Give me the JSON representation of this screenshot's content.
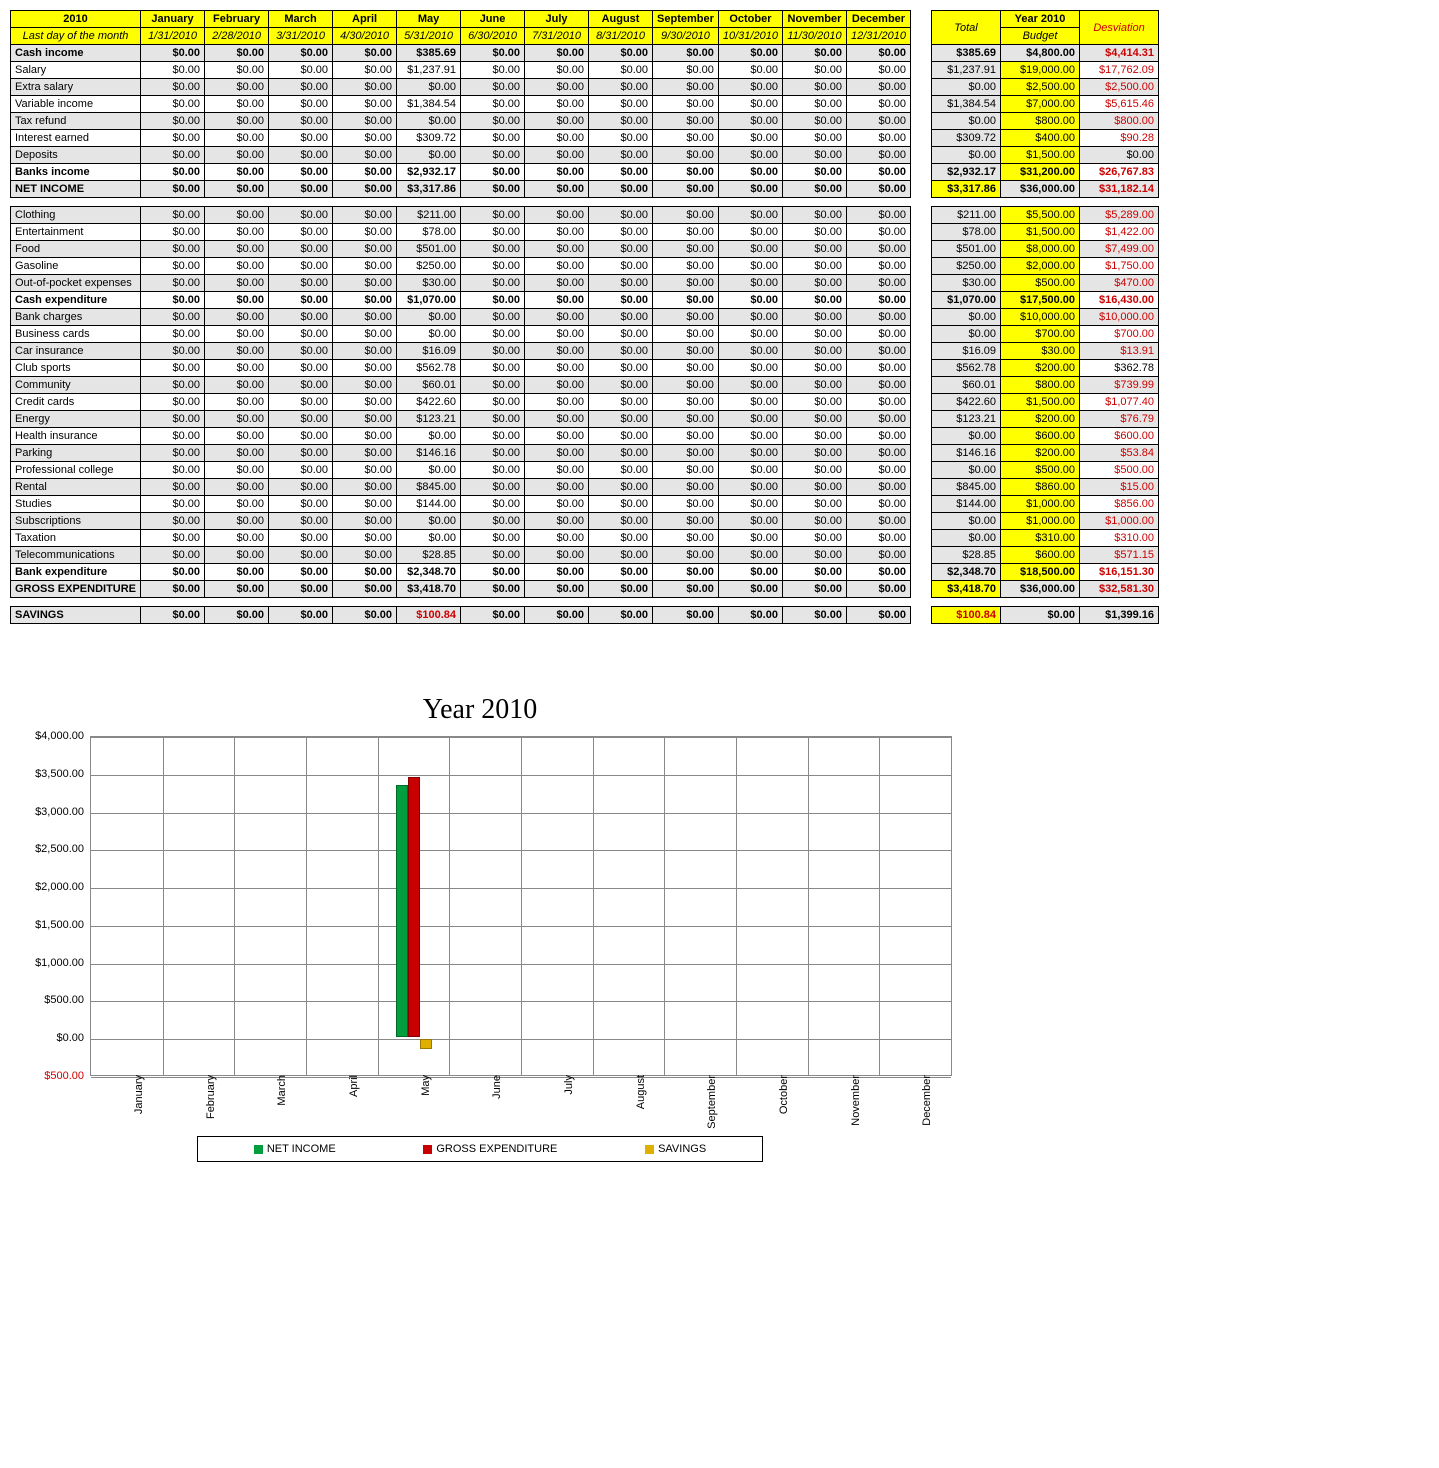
{
  "header": {
    "year": "2010",
    "subtitle": "Last day of the month",
    "months": [
      "January",
      "February",
      "March",
      "April",
      "May",
      "June",
      "July",
      "August",
      "September",
      "October",
      "November",
      "December"
    ],
    "dates": [
      "1/31/2010",
      "2/28/2010",
      "3/31/2010",
      "4/30/2010",
      "5/31/2010",
      "6/30/2010",
      "7/31/2010",
      "8/31/2010",
      "9/30/2010",
      "10/31/2010",
      "11/30/2010",
      "12/31/2010"
    ],
    "side": {
      "total": "Total",
      "budget_top": "Year 2010",
      "budget_sub": "Budget",
      "dev": "Desviation"
    }
  },
  "rows": [
    {
      "label": "Cash income",
      "style": "alt bold",
      "may": "$385.69",
      "total": "$385.69",
      "budget": "$4,800.00",
      "dev": "$4,414.31"
    },
    {
      "label": "Salary",
      "style": "",
      "may": "$1,237.91",
      "total": "$1,237.91",
      "budget": "$19,000.00",
      "dev": "$17,762.09"
    },
    {
      "label": "Extra salary",
      "style": "alt",
      "may": "$0.00",
      "total": "$0.00",
      "budget": "$2,500.00",
      "dev": "$2,500.00"
    },
    {
      "label": "Variable income",
      "style": "",
      "may": "$1,384.54",
      "total": "$1,384.54",
      "budget": "$7,000.00",
      "dev": "$5,615.46"
    },
    {
      "label": "Tax refund",
      "style": "alt",
      "may": "$0.00",
      "total": "$0.00",
      "budget": "$800.00",
      "dev": "$800.00"
    },
    {
      "label": "Interest earned",
      "style": "",
      "may": "$309.72",
      "total": "$309.72",
      "budget": "$400.00",
      "dev": "$90.28"
    },
    {
      "label": "Deposits",
      "style": "alt",
      "may": "$0.00",
      "total": "$0.00",
      "budget": "$1,500.00",
      "dev": "$0.00",
      "devBlack": true
    },
    {
      "label": "Banks income",
      "style": "bold",
      "may": "$2,932.17",
      "total": "$2,932.17",
      "budget": "$31,200.00",
      "dev": "$26,767.83"
    },
    {
      "label": "NET INCOME",
      "style": "alt bold",
      "may": "$3,317.86",
      "total": "$3,317.86",
      "totalYellow": true,
      "budget": "$36,000.00",
      "dev": "$31,182.14"
    },
    {
      "spacer": true
    },
    {
      "label": "Clothing",
      "style": "alt",
      "may": "$211.00",
      "total": "$211.00",
      "budget": "$5,500.00",
      "dev": "$5,289.00"
    },
    {
      "label": "Entertainment",
      "style": "",
      "may": "$78.00",
      "total": "$78.00",
      "budget": "$1,500.00",
      "dev": "$1,422.00"
    },
    {
      "label": "Food",
      "style": "alt",
      "may": "$501.00",
      "total": "$501.00",
      "budget": "$8,000.00",
      "dev": "$7,499.00"
    },
    {
      "label": "Gasoline",
      "style": "",
      "may": "$250.00",
      "total": "$250.00",
      "budget": "$2,000.00",
      "dev": "$1,750.00"
    },
    {
      "label": "Out-of-pocket expenses",
      "style": "alt",
      "may": "$30.00",
      "total": "$30.00",
      "budget": "$500.00",
      "dev": "$470.00"
    },
    {
      "label": "Cash expenditure",
      "style": "bold",
      "may": "$1,070.00",
      "total": "$1,070.00",
      "budget": "$17,500.00",
      "dev": "$16,430.00"
    },
    {
      "label": "Bank charges",
      "style": "alt",
      "may": "$0.00",
      "total": "$0.00",
      "budget": "$10,000.00",
      "dev": "$10,000.00"
    },
    {
      "label": "Business cards",
      "style": "",
      "may": "$0.00",
      "total": "$0.00",
      "budget": "$700.00",
      "dev": "$700.00"
    },
    {
      "label": "Car insurance",
      "style": "alt",
      "may": "$16.09",
      "total": "$16.09",
      "budget": "$30.00",
      "dev": "$13.91"
    },
    {
      "label": "Club sports",
      "style": "",
      "may": "$562.78",
      "total": "$562.78",
      "budget": "$200.00",
      "dev": "$362.78",
      "devBlack": true
    },
    {
      "label": "Community",
      "style": "alt",
      "may": "$60.01",
      "total": "$60.01",
      "budget": "$800.00",
      "dev": "$739.99"
    },
    {
      "label": "Credit cards",
      "style": "",
      "may": "$422.60",
      "total": "$422.60",
      "budget": "$1,500.00",
      "dev": "$1,077.40"
    },
    {
      "label": "Energy",
      "style": "alt",
      "may": "$123.21",
      "total": "$123.21",
      "budget": "$200.00",
      "dev": "$76.79"
    },
    {
      "label": "Health insurance",
      "style": "",
      "may": "$0.00",
      "total": "$0.00",
      "budget": "$600.00",
      "dev": "$600.00"
    },
    {
      "label": "Parking",
      "style": "alt",
      "may": "$146.16",
      "total": "$146.16",
      "budget": "$200.00",
      "dev": "$53.84"
    },
    {
      "label": "Professional college",
      "style": "",
      "may": "$0.00",
      "total": "$0.00",
      "budget": "$500.00",
      "dev": "$500.00"
    },
    {
      "label": "Rental",
      "style": "alt",
      "may": "$845.00",
      "total": "$845.00",
      "budget": "$860.00",
      "dev": "$15.00"
    },
    {
      "label": "Studies",
      "style": "",
      "may": "$144.00",
      "total": "$144.00",
      "budget": "$1,000.00",
      "dev": "$856.00"
    },
    {
      "label": "Subscriptions",
      "style": "alt",
      "may": "$0.00",
      "total": "$0.00",
      "budget": "$1,000.00",
      "dev": "$1,000.00"
    },
    {
      "label": "Taxation",
      "style": "",
      "may": "$0.00",
      "total": "$0.00",
      "budget": "$310.00",
      "dev": "$310.00"
    },
    {
      "label": "Telecommunications",
      "style": "alt",
      "may": "$28.85",
      "total": "$28.85",
      "budget": "$600.00",
      "dev": "$571.15"
    },
    {
      "label": "Bank expenditure",
      "style": "bold",
      "may": "$2,348.70",
      "total": "$2,348.70",
      "budget": "$18,500.00",
      "dev": "$16,151.30"
    },
    {
      "label": "GROSS EXPENDITURE",
      "style": "alt bold",
      "may": "$3,418.70",
      "total": "$3,418.70",
      "totalYellow": true,
      "budget": "$36,000.00",
      "dev": "$32,581.30"
    },
    {
      "spacer": true
    },
    {
      "label": "SAVINGS",
      "style": "alt bold",
      "may": "$100.84",
      "mayRed": true,
      "total": "$100.84",
      "totalYellow": true,
      "totalRed": true,
      "budget": "$0.00",
      "dev": "$1,399.16",
      "devBlack": true
    }
  ],
  "zero": "$0.00",
  "chart_data": {
    "type": "bar",
    "title": "Year 2010",
    "categories": [
      "January",
      "February",
      "March",
      "April",
      "May",
      "June",
      "July",
      "August",
      "September",
      "October",
      "November",
      "December"
    ],
    "series": [
      {
        "name": "NET INCOME",
        "color": "#009e3d",
        "values": [
          0,
          0,
          0,
          0,
          3317.86,
          0,
          0,
          0,
          0,
          0,
          0,
          0
        ]
      },
      {
        "name": "GROSS EXPENDITURE",
        "color": "#c80000",
        "values": [
          0,
          0,
          0,
          0,
          3418.7,
          0,
          0,
          0,
          0,
          0,
          0,
          0
        ]
      },
      {
        "name": "SAVINGS",
        "color": "#e0b000",
        "values": [
          0,
          0,
          0,
          0,
          -100.84,
          0,
          0,
          0,
          0,
          0,
          0,
          0
        ]
      }
    ],
    "ylim": [
      -500,
      4000
    ],
    "yticks": [
      "$500.00",
      "$0.00",
      "$500.00",
      "$1,000.00",
      "$1,500.00",
      "$2,000.00",
      "$2,500.00",
      "$3,000.00",
      "$3,500.00",
      "$4,000.00"
    ],
    "ytick_values": [
      -500,
      0,
      500,
      1000,
      1500,
      2000,
      2500,
      3000,
      3500,
      4000
    ]
  },
  "legend": {
    "a": "NET INCOME",
    "b": "GROSS EXPENDITURE",
    "c": "SAVINGS"
  }
}
